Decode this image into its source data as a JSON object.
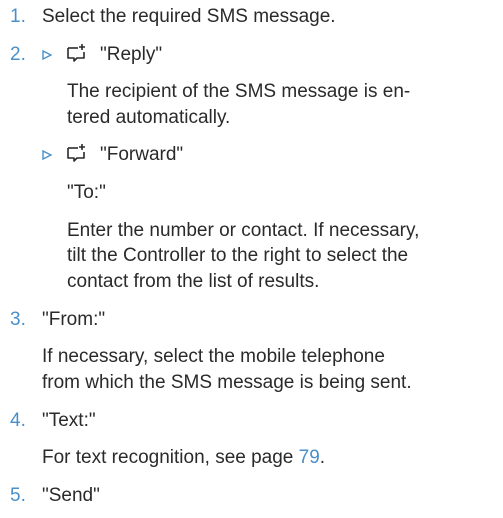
{
  "steps": [
    {
      "num": "1.",
      "text": "Select the required SMS message."
    },
    {
      "num": "2.",
      "reply": "\"Reply\"",
      "reply_note_1": "The recipient of the SMS message is en-",
      "reply_note_2": "tered automatically.",
      "forward": "\"Forward\"",
      "to": "\"To:\"",
      "to_note_1": "Enter the number or contact. If necessary,",
      "to_note_2": "tilt the Controller to the right to select the",
      "to_note_3": "contact from the list of results."
    },
    {
      "num": "3.",
      "text": "\"From:\"",
      "note_1": "If necessary, select the mobile telephone",
      "note_2": "from which the SMS message is being sent."
    },
    {
      "num": "4.",
      "text": "\"Text:\"",
      "note_prefix": "For text recognition, see page ",
      "page_link": "79",
      "note_suffix": "."
    },
    {
      "num": "5.",
      "text": "\"Send\""
    }
  ],
  "colors": {
    "accent": "#4a8fc9",
    "text": "#2a2a2a"
  },
  "icons": {
    "menu_option": "options-menu-icon",
    "arrow": "triangle-right-icon"
  }
}
